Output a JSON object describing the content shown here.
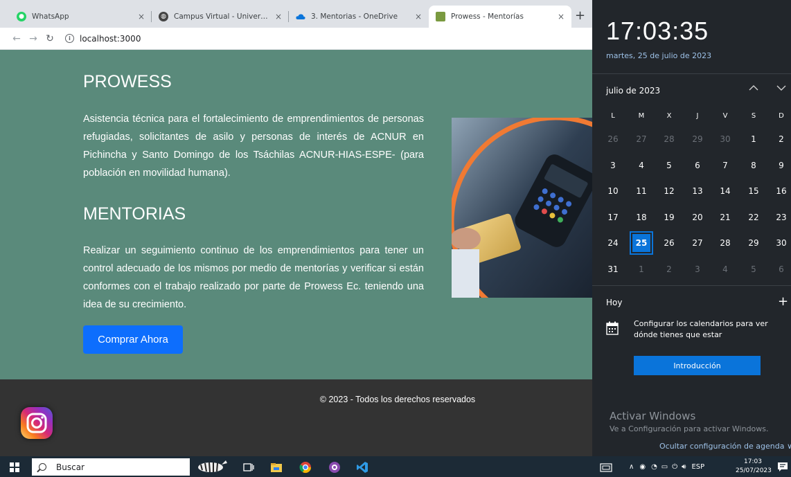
{
  "browser": {
    "tabs": [
      {
        "title": "WhatsApp",
        "icon": "whatsapp-icon",
        "icon_color": "#25d366"
      },
      {
        "title": "Campus Virtual - Universidad de",
        "icon": "globe-icon",
        "icon_color": "#444444"
      },
      {
        "title": "3. Mentorias - OneDrive",
        "icon": "onedrive-icon",
        "icon_color": "#0a74da"
      },
      {
        "title": "Prowess - Mentorías",
        "icon": "page-icon",
        "icon_color": "#7a9a40"
      }
    ],
    "close_glyph": "×",
    "new_tab_glyph": "+",
    "url": "localhost:3000",
    "info_glyph": "i"
  },
  "page": {
    "section1": {
      "heading": "PROWESS",
      "text": "Asistencia técnica para el fortalecimiento de emprendimientos de personas refugiadas, solicitantes de asilo y personas de interés de ACNUR en Pichincha y Santo Domingo de los Tsáchilas ACNUR-HIAS-ESPE- (para población en movilidad humana)."
    },
    "section2": {
      "heading": "MENTORIAS",
      "text": "Realizar un seguimiento continuo de los emprendimientos para tener un control adecuado de los mismos por medio de mentorías y verificar si están conformes con el trabajo realizado por parte de Prowess Ec. teniendo una idea de su crecimiento."
    },
    "buy_button": "Comprar Ahora",
    "footer": "© 2023 - Todos los derechos reservados",
    "colors": {
      "background": "#5a8a7b",
      "button": "#0d6efd",
      "footer": "#333333"
    }
  },
  "calendar": {
    "time": "17:03:35",
    "date_long": "martes, 25 de julio de 2023",
    "month": "julio de 2023",
    "weekdays": [
      "L",
      "M",
      "X",
      "J",
      "V",
      "S",
      "D"
    ],
    "weeks": [
      [
        {
          "d": "26",
          "dim": true
        },
        {
          "d": "27",
          "dim": true
        },
        {
          "d": "28",
          "dim": true
        },
        {
          "d": "29",
          "dim": true
        },
        {
          "d": "30",
          "dim": true
        },
        {
          "d": "1"
        },
        {
          "d": "2"
        }
      ],
      [
        {
          "d": "3"
        },
        {
          "d": "4"
        },
        {
          "d": "5"
        },
        {
          "d": "6"
        },
        {
          "d": "7"
        },
        {
          "d": "8"
        },
        {
          "d": "9"
        }
      ],
      [
        {
          "d": "10"
        },
        {
          "d": "11"
        },
        {
          "d": "12"
        },
        {
          "d": "13"
        },
        {
          "d": "14"
        },
        {
          "d": "15"
        },
        {
          "d": "16"
        }
      ],
      [
        {
          "d": "17"
        },
        {
          "d": "18"
        },
        {
          "d": "19"
        },
        {
          "d": "20"
        },
        {
          "d": "21"
        },
        {
          "d": "22"
        },
        {
          "d": "23"
        }
      ],
      [
        {
          "d": "24"
        },
        {
          "d": "25",
          "today": true
        },
        {
          "d": "26"
        },
        {
          "d": "27"
        },
        {
          "d": "28"
        },
        {
          "d": "29"
        },
        {
          "d": "30"
        }
      ],
      [
        {
          "d": "31"
        },
        {
          "d": "1",
          "dim": true
        },
        {
          "d": "2",
          "dim": true
        },
        {
          "d": "3",
          "dim": true
        },
        {
          "d": "4",
          "dim": true
        },
        {
          "d": "5",
          "dim": true
        },
        {
          "d": "6",
          "dim": true
        }
      ]
    ],
    "agenda_title": "Hoy",
    "add_glyph": "+",
    "config_text": "Configurar los calendarios para ver dónde tienes que estar",
    "intro_button": "Introducción",
    "activate_title": "Activar Windows",
    "activate_sub": "Ve a Configuración para activar Windows.",
    "hide_agenda": "Ocultar configuración de agenda",
    "accent": "#0a74da"
  },
  "taskbar": {
    "search_placeholder": "Buscar",
    "lang": "ESP",
    "time": "17:03",
    "date": "25/07/2023"
  }
}
